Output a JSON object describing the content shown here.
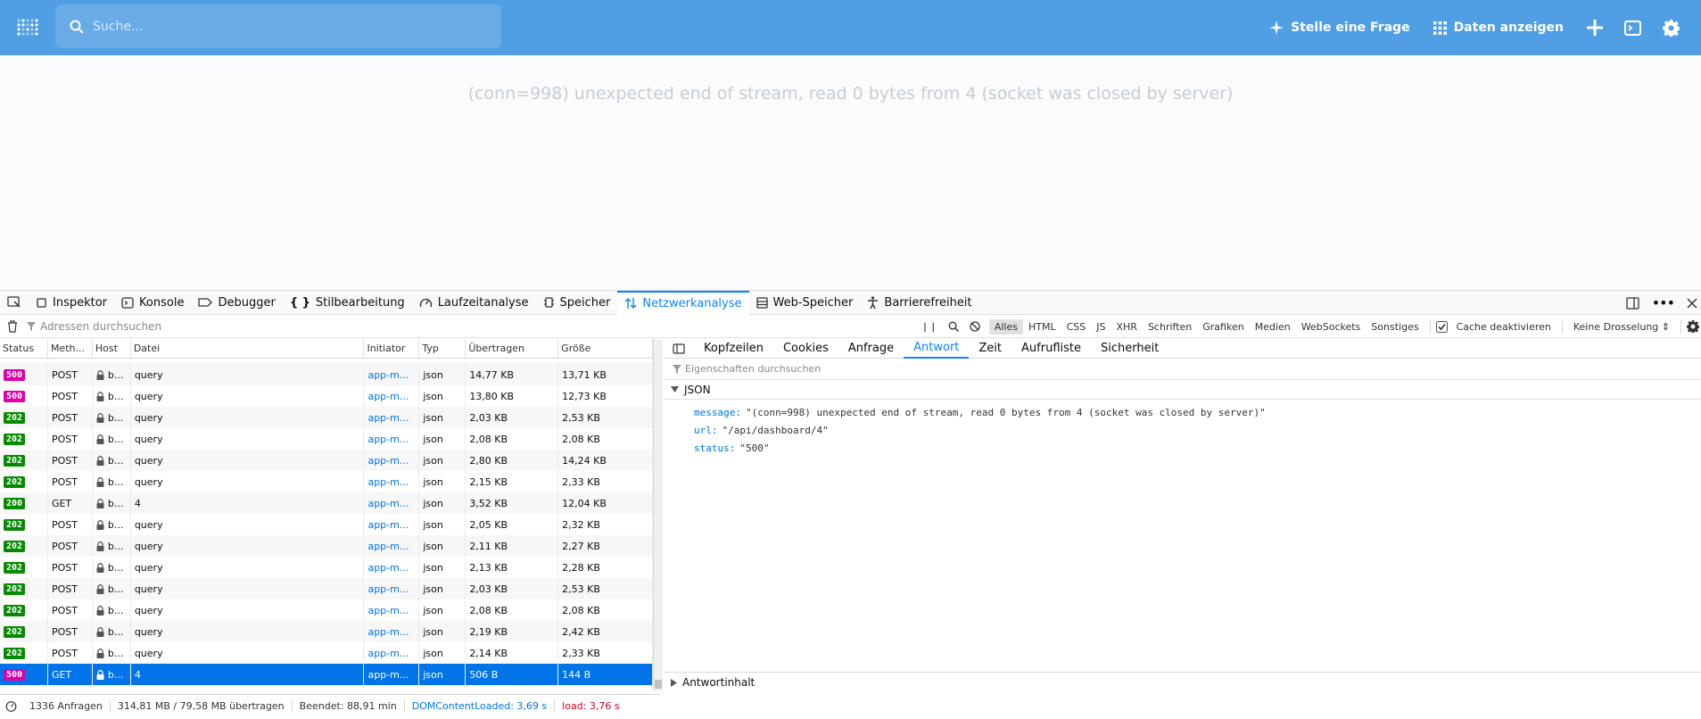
{
  "topbar": {
    "search_placeholder": "Suche...",
    "ask_label": "Stelle eine Frage",
    "browse_label": "Daten anzeigen",
    "accent": "#509ee3"
  },
  "error_message": "(conn=998) unexpected end of stream, read 0 bytes from 4 (socket was closed by server)",
  "devtools": {
    "tabs": [
      {
        "label": "Inspektor",
        "icon": "inspector-icon"
      },
      {
        "label": "Konsole",
        "icon": "console-icon"
      },
      {
        "label": "Debugger",
        "icon": "debugger-icon"
      },
      {
        "label": "Stilbearbeitung",
        "icon": "style-editor-icon"
      },
      {
        "label": "Laufzeitanalyse",
        "icon": "performance-icon"
      },
      {
        "label": "Speicher",
        "icon": "memory-icon"
      },
      {
        "label": "Netzwerkanalyse",
        "icon": "network-icon",
        "active": true
      },
      {
        "label": "Web-Speicher",
        "icon": "storage-icon"
      },
      {
        "label": "Barrierefreiheit",
        "icon": "accessibility-icon"
      }
    ],
    "filter_placeholder": "Adressen durchsuchen",
    "type_filters": [
      "Alles",
      "HTML",
      "CSS",
      "JS",
      "XHR",
      "Schriften",
      "Grafiken",
      "Medien",
      "WebSockets",
      "Sonstiges"
    ],
    "cache_label": "Cache deaktivieren",
    "throttle_label": "Keine Drosselung ⇕",
    "columns": [
      "Status",
      "Meth...",
      "Host",
      "Datei",
      "Initiator",
      "Typ",
      "Übertragen",
      "Größe"
    ],
    "rows": [
      {
        "status": "500",
        "method": "POST",
        "host": "b...",
        "file": "query",
        "initiator": "app-m...",
        "type": "json",
        "transferred": "14,77 KB",
        "size": "13,71 KB"
      },
      {
        "status": "500",
        "method": "POST",
        "host": "b...",
        "file": "query",
        "initiator": "app-m...",
        "type": "json",
        "transferred": "13,80 KB",
        "size": "12,73 KB"
      },
      {
        "status": "202",
        "method": "POST",
        "host": "b...",
        "file": "query",
        "initiator": "app-m...",
        "type": "json",
        "transferred": "2,03 KB",
        "size": "2,53 KB"
      },
      {
        "status": "202",
        "method": "POST",
        "host": "b...",
        "file": "query",
        "initiator": "app-m...",
        "type": "json",
        "transferred": "2,08 KB",
        "size": "2,08 KB"
      },
      {
        "status": "202",
        "method": "POST",
        "host": "b...",
        "file": "query",
        "initiator": "app-m...",
        "type": "json",
        "transferred": "2,80 KB",
        "size": "14,24 KB"
      },
      {
        "status": "202",
        "method": "POST",
        "host": "b...",
        "file": "query",
        "initiator": "app-m...",
        "type": "json",
        "transferred": "2,15 KB",
        "size": "2,33 KB"
      },
      {
        "status": "200",
        "method": "GET",
        "host": "b...",
        "file": "4",
        "initiator": "app-m...",
        "type": "json",
        "transferred": "3,52 KB",
        "size": "12,04 KB"
      },
      {
        "status": "202",
        "method": "POST",
        "host": "b...",
        "file": "query",
        "initiator": "app-m...",
        "type": "json",
        "transferred": "2,05 KB",
        "size": "2,32 KB"
      },
      {
        "status": "202",
        "method": "POST",
        "host": "b...",
        "file": "query",
        "initiator": "app-m...",
        "type": "json",
        "transferred": "2,11 KB",
        "size": "2,27 KB"
      },
      {
        "status": "202",
        "method": "POST",
        "host": "b...",
        "file": "query",
        "initiator": "app-m...",
        "type": "json",
        "transferred": "2,13 KB",
        "size": "2,28 KB"
      },
      {
        "status": "202",
        "method": "POST",
        "host": "b...",
        "file": "query",
        "initiator": "app-m...",
        "type": "json",
        "transferred": "2,03 KB",
        "size": "2,53 KB"
      },
      {
        "status": "202",
        "method": "POST",
        "host": "b...",
        "file": "query",
        "initiator": "app-m...",
        "type": "json",
        "transferred": "2,08 KB",
        "size": "2,08 KB"
      },
      {
        "status": "202",
        "method": "POST",
        "host": "b...",
        "file": "query",
        "initiator": "app-m...",
        "type": "json",
        "transferred": "2,19 KB",
        "size": "2,42 KB"
      },
      {
        "status": "202",
        "method": "POST",
        "host": "b...",
        "file": "query",
        "initiator": "app-m...",
        "type": "json",
        "transferred": "2,14 KB",
        "size": "2,33 KB"
      },
      {
        "status": "500",
        "method": "GET",
        "host": "b...",
        "file": "4",
        "initiator": "app-m...",
        "type": "json",
        "transferred": "506 B",
        "size": "144 B",
        "selected": true
      }
    ],
    "status_colors": {
      "500": "#dd00a9",
      "202": "#058b00",
      "200": "#058b00"
    },
    "detail_tabs": [
      "Kopfzeilen",
      "Cookies",
      "Anfrage",
      "Antwort",
      "Zeit",
      "Aufrufliste",
      "Sicherheit"
    ],
    "detail_active": "Antwort",
    "prop_placeholder": "Eigenschaften durchsuchen",
    "json_label": "JSON",
    "json_props": [
      {
        "key": "message:",
        "value": "\"(conn=998) unexpected end of stream, read 0 bytes from 4 (socket was closed by server)\""
      },
      {
        "key": "url:",
        "value": "\"/api/dashboard/4\""
      },
      {
        "key": "status:",
        "value": "\"500\""
      }
    ],
    "response_body_label": "Antwortinhalt",
    "summary": {
      "requests": "1336 Anfragen",
      "transferred": "314,81 MB / 79,58 MB übertragen",
      "finished": "Beendet: 88,91 min",
      "dom_loaded": "DOMContentLoaded: 3,69 s",
      "load": "load: 3,76 s"
    }
  }
}
